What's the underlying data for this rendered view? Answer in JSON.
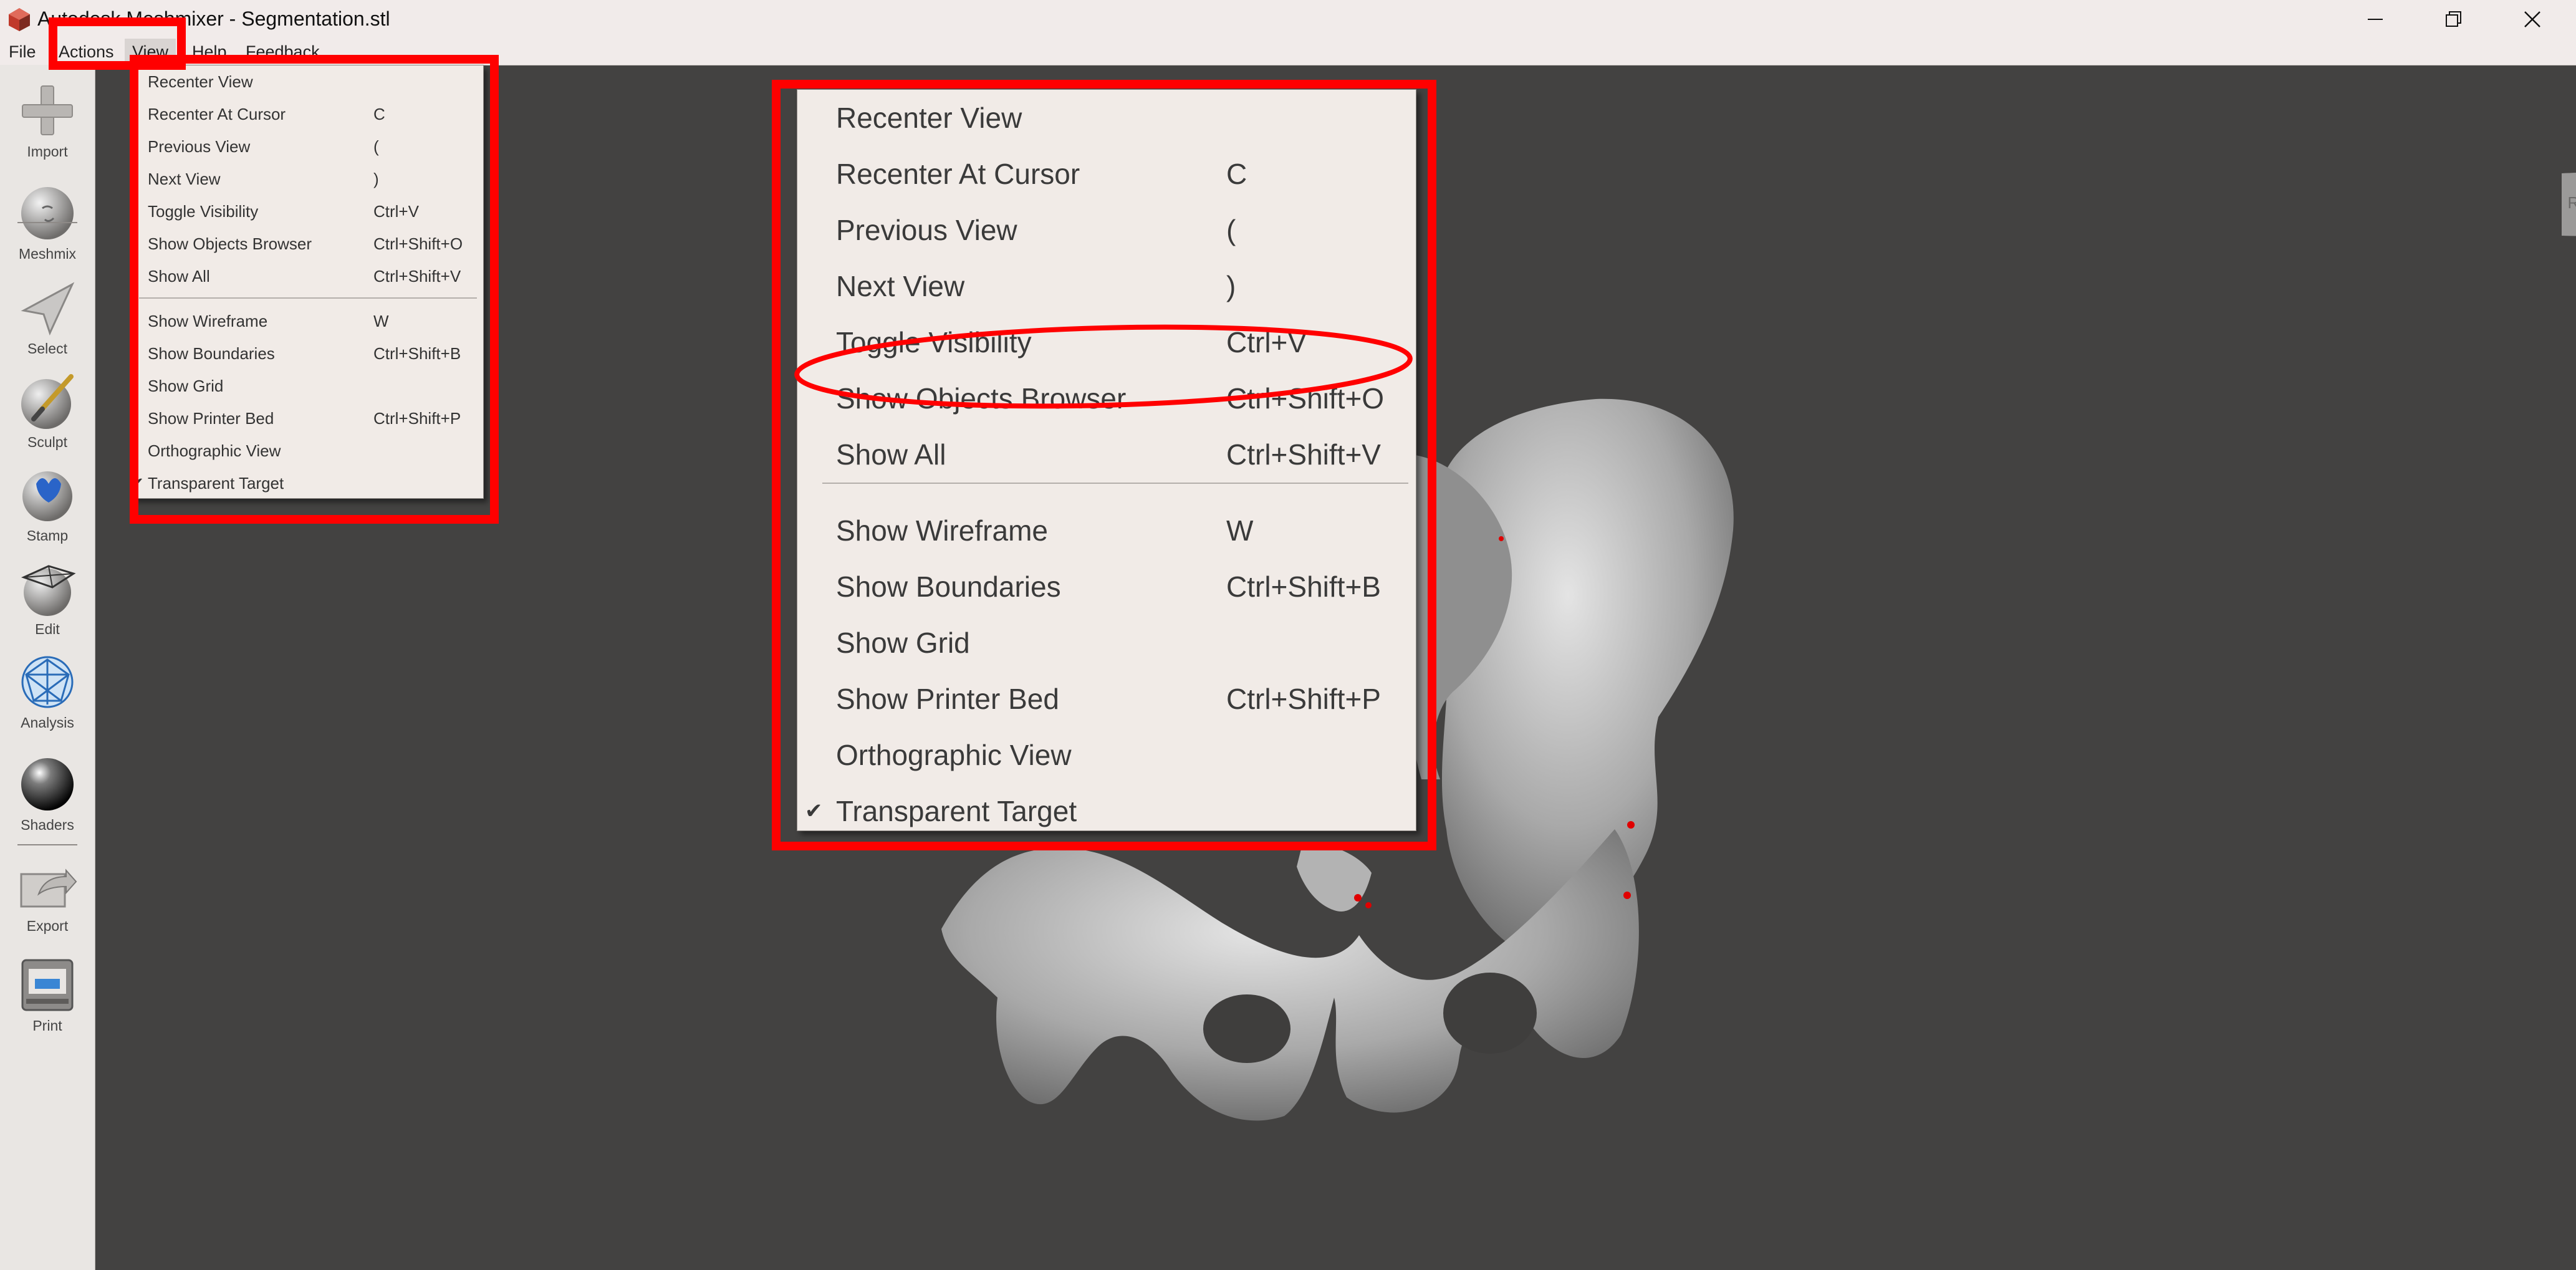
{
  "window": {
    "title": "Autodesk Meshmixer - Segmentation.stl",
    "controls": [
      "minimize",
      "maximize",
      "close"
    ]
  },
  "menubar": {
    "items": [
      {
        "label": "File"
      },
      {
        "label": "Actions"
      },
      {
        "label": "View",
        "active": true
      },
      {
        "label": "Help"
      },
      {
        "label": "Feedback"
      }
    ]
  },
  "toolbar": {
    "tools": [
      {
        "label": "Import",
        "icon": "plus-icon"
      },
      {
        "label": "Meshmix",
        "icon": "meshmix-icon"
      },
      {
        "label": "Select",
        "icon": "select-arrow-icon"
      },
      {
        "label": "Sculpt",
        "icon": "sculpt-brush-icon"
      },
      {
        "label": "Stamp",
        "icon": "stamp-icon"
      },
      {
        "label": "Edit",
        "icon": "edit-mesh-icon"
      },
      {
        "label": "Analysis",
        "icon": "analysis-icon"
      },
      {
        "label": "Shaders",
        "icon": "shader-sphere-icon"
      },
      {
        "label": "Export",
        "icon": "export-icon"
      },
      {
        "label": "Print",
        "icon": "printer-icon"
      }
    ]
  },
  "view_menu": {
    "items": [
      {
        "label": "Recenter View",
        "shortcut": ""
      },
      {
        "label": "Recenter At Cursor",
        "shortcut": "C"
      },
      {
        "label": "Previous View",
        "shortcut": "("
      },
      {
        "label": "Next View",
        "shortcut": ")"
      },
      {
        "label": "Toggle Visibility",
        "shortcut": "Ctrl+V"
      },
      {
        "label": "Show Objects Browser",
        "shortcut": "Ctrl+Shift+O"
      },
      {
        "label": "Show All",
        "shortcut": "Ctrl+Shift+V"
      },
      {
        "label": "Show Wireframe",
        "shortcut": "W"
      },
      {
        "label": "Show Boundaries",
        "shortcut": "Ctrl+Shift+B"
      },
      {
        "label": "Show Grid",
        "shortcut": ""
      },
      {
        "label": "Show Printer Bed",
        "shortcut": "Ctrl+Shift+P"
      },
      {
        "label": "Orthographic View",
        "shortcut": ""
      },
      {
        "label": "Transparent Target",
        "shortcut": "",
        "checked": true,
        "check_mark": "✔"
      }
    ]
  },
  "view_cube": {
    "label": "RIGHT"
  },
  "annotation": {
    "color": "#ff0000"
  },
  "colors": {
    "viewport": "#434241",
    "toolbar": "#e9e6e3",
    "menu": "#f1ebe7",
    "mesh": "#b7b7b7"
  }
}
